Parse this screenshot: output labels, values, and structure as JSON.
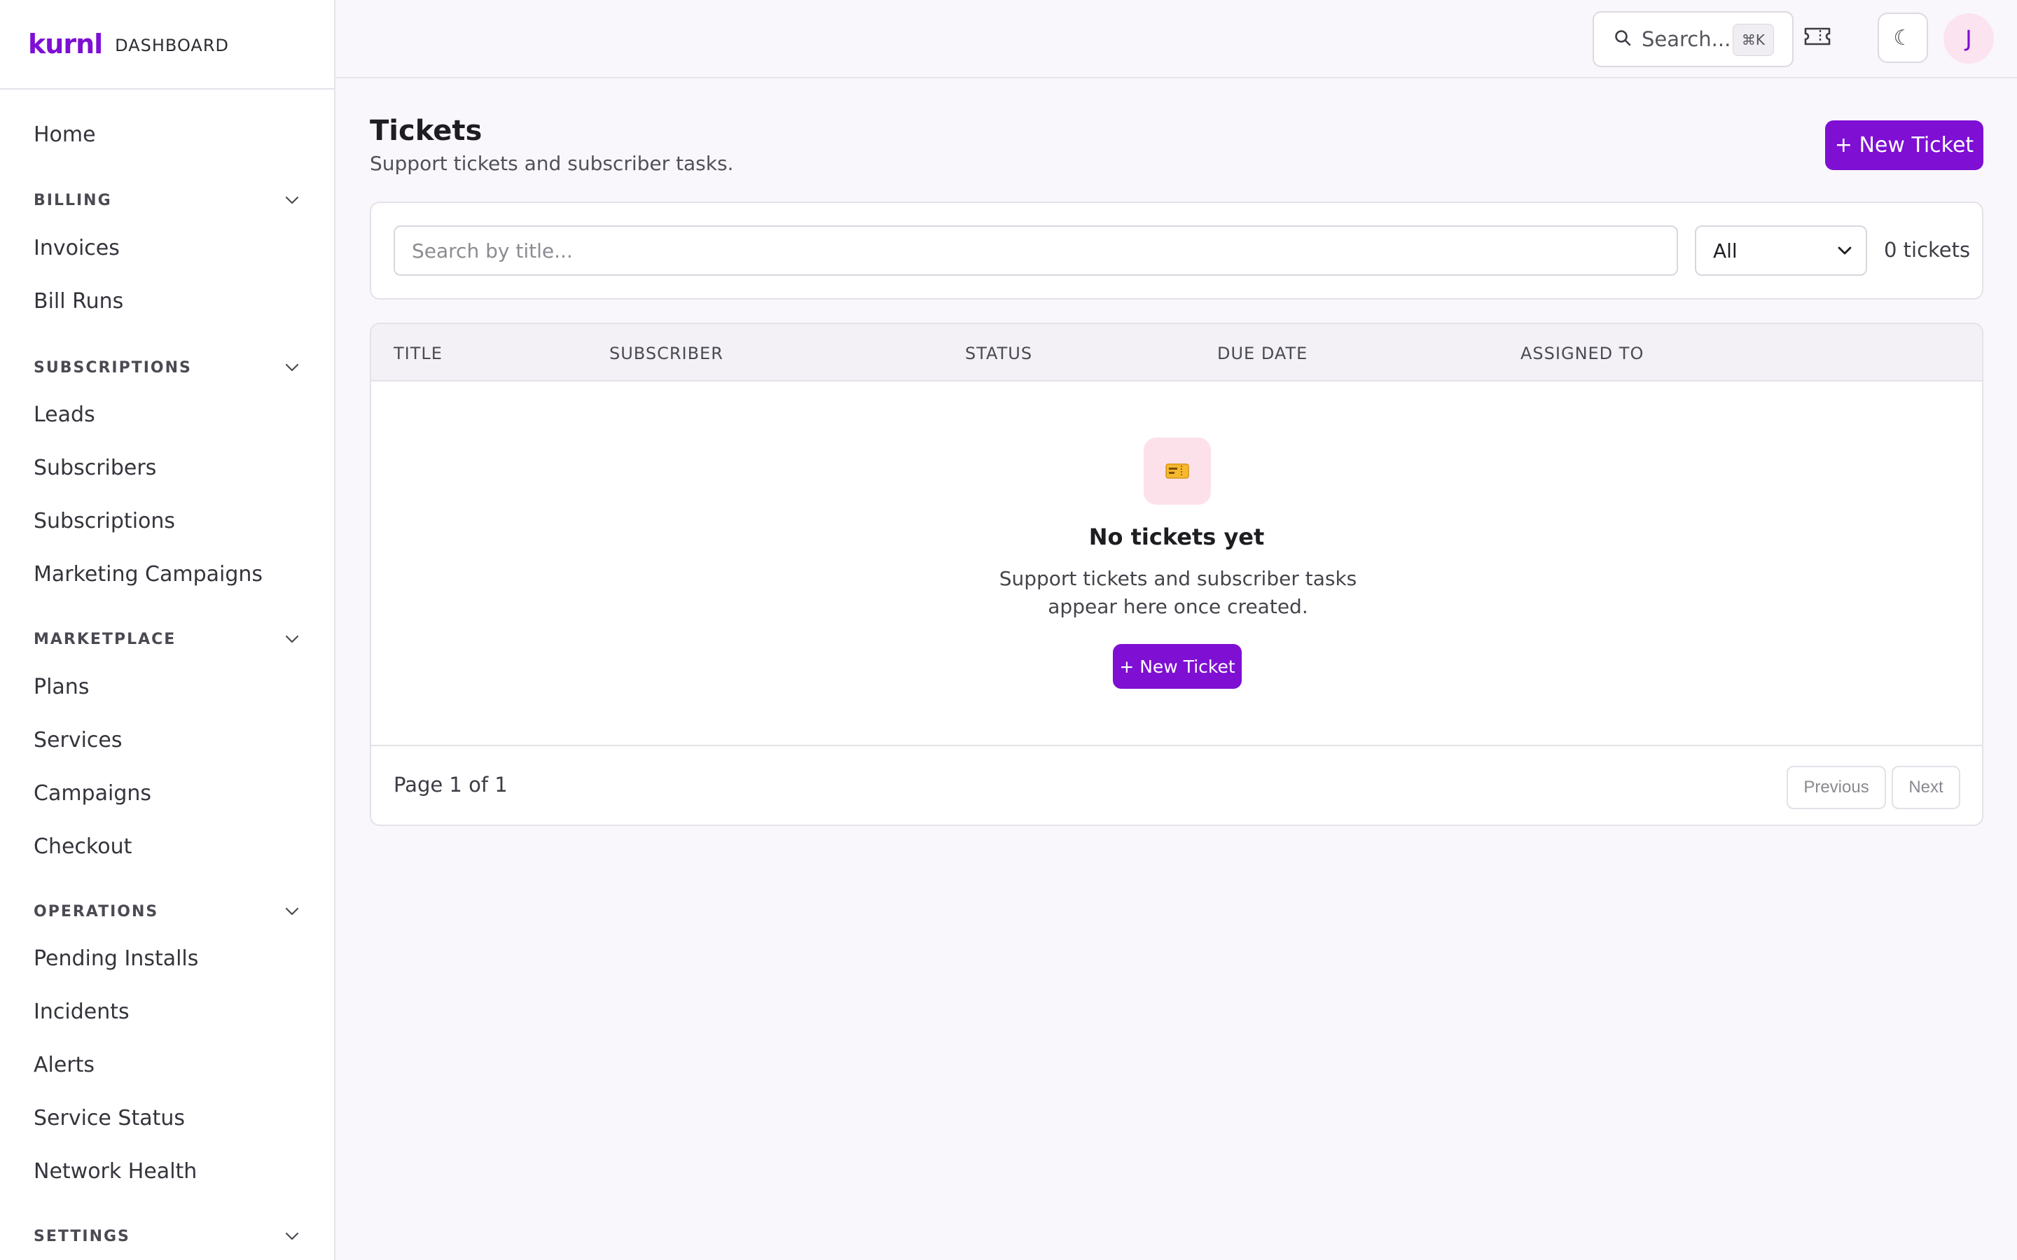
{
  "brand": {
    "logo": "kurnl",
    "subtitle": "DASHBOARD"
  },
  "sidebar": {
    "home": "Home",
    "sections": [
      {
        "label": "BILLING",
        "items": [
          "Invoices",
          "Bill Runs"
        ]
      },
      {
        "label": "SUBSCRIPTIONS",
        "items": [
          "Leads",
          "Subscribers",
          "Subscriptions",
          "Marketing Campaigns"
        ]
      },
      {
        "label": "MARKETPLACE",
        "items": [
          "Plans",
          "Services",
          "Campaigns",
          "Checkout"
        ]
      },
      {
        "label": "OPERATIONS",
        "items": [
          "Pending Installs",
          "Incidents",
          "Alerts",
          "Service Status",
          "Network Health"
        ]
      },
      {
        "label": "SETTINGS",
        "items": []
      }
    ]
  },
  "topbar": {
    "search_label": "Search...",
    "search_shortcut": "⌘K",
    "theme_icon": "☾",
    "avatar_initial": "J"
  },
  "page": {
    "title": "Tickets",
    "subtitle": "Support tickets and subscriber tasks.",
    "new_ticket_label": "+ New Ticket"
  },
  "filters": {
    "search_placeholder": "Search by title...",
    "status_value": "All",
    "count_text": "0 tickets"
  },
  "table": {
    "columns": [
      "TITLE",
      "SUBSCRIBER",
      "STATUS",
      "DUE DATE",
      "ASSIGNED TO"
    ],
    "empty": {
      "title": "No tickets yet",
      "description": "Support tickets and subscriber tasks appear here once created.",
      "button_label": "+ New Ticket"
    },
    "pagination": {
      "info": "Page 1 of 1",
      "prev": "Previous",
      "next": "Next"
    }
  },
  "colors": {
    "accent": "#7e0fd3",
    "background": "#f9f7fb",
    "empty_icon_bg": "#fde1ea"
  }
}
